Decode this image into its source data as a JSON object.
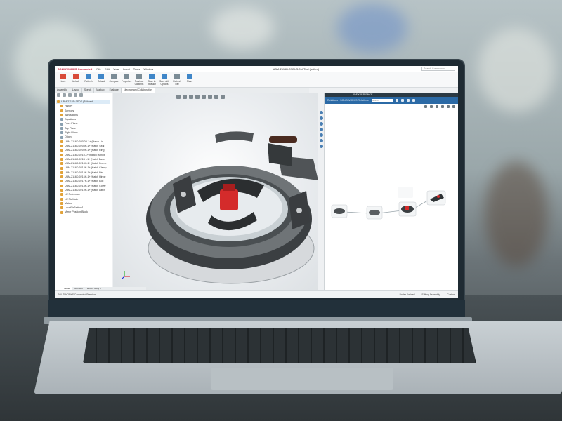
{
  "app": {
    "brand": "SOLIDWORKS Connected",
    "menus": [
      "File",
      "Edit",
      "View",
      "Insert",
      "Tools",
      "Window"
    ],
    "doc_title": "UBM-2116D-0SDLS-0N-Tfall (united)",
    "search_placeholder": "Search Commands"
  },
  "ribbon": {
    "buttons": [
      "Lock",
      "Unlock",
      "Refresh",
      "Reload",
      "Compare",
      "Properties",
      "Previous Contents",
      "Save to Revision",
      "Save with Options",
      "Refresh Ref",
      "Share"
    ]
  },
  "command_tabs": [
    "Assembly",
    "Layout",
    "Sketch",
    "Markup",
    "Evaluate",
    "Lifecycle and Collaboration"
  ],
  "tree": {
    "items": [
      "UBM-2116D-0SDS (Tailored)",
      "History",
      "Sensors",
      "Annotations",
      "Equations",
      "Front Plane",
      "Top Plane",
      "Right Plane",
      "Origin",
      "UBM-2116D-0207W-1+ (Hatch Lid",
      "UBM-2116D-0208H-1+ (Hatch Seal",
      "UBM-2116D-0209H-1+ (Hatch Ring",
      "UBM-2116D-0210-1+ (Hatch Handle",
      "UBM-2116D-0211H-1+ (Hatch Base",
      "UBM-2116D-0213H-1+ (Hatch Frame",
      "UBM-2116D-0214H-1+ (Hatch Clamp",
      "UBM-2116D-0215H-1+ (Hatch Pin",
      "UBM-2116D-0216H-1+ (Hatch Hinge",
      "UBM-2116D-0217H-1+ (Hatch Bolt",
      "UBM-2116D-0218H-1+ (Hatch Cover",
      "UBM-2116D-0219H-1+ (Hatch Latch",
      "LU Reference",
      "LU Fix Mate",
      "Mates",
      "LocalCirPattern1",
      "Mirror Position Block"
    ]
  },
  "panel": {
    "title": "3DEXPERIENCE",
    "tab": "Relations - SOLIDWORKS Relations",
    "search_placeholder": "Search"
  },
  "bottom_tabs": [
    "Model",
    "3D Views",
    "Motion Study 1"
  ],
  "status": {
    "left": "SOLIDWORKS Connected Premium",
    "middle": "Under Defined",
    "mode": "Editing Assembly",
    "units": "Custom"
  }
}
